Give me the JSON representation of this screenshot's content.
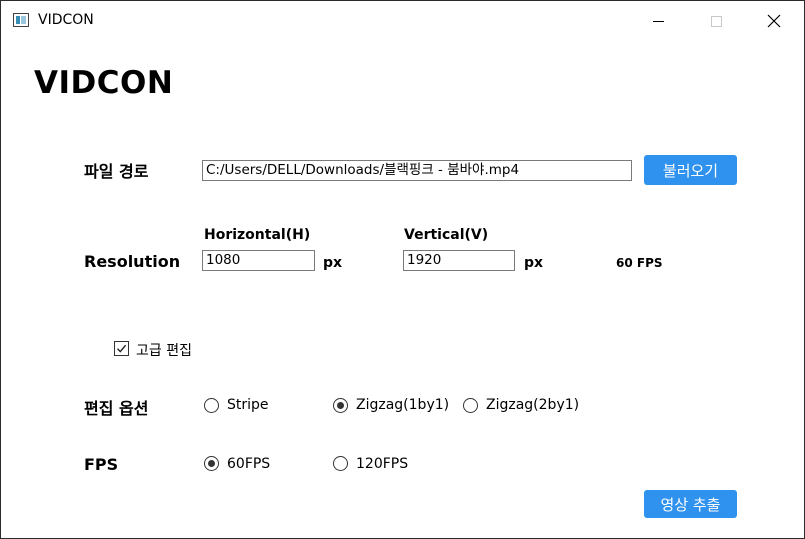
{
  "window": {
    "title": "VIDCON",
    "controls": {
      "minimize": "minimize",
      "maximize": "maximize",
      "close": "close"
    }
  },
  "heading": "VIDCON",
  "file_path": {
    "label": "파일 경로",
    "value": "C:/Users/DELL/Downloads/블랙핑크 - 붐바야.mp4",
    "load_button": "불러오기"
  },
  "resolution": {
    "label": "Resolution",
    "horizontal_label": "Horizontal(H)",
    "horizontal_value": "1080",
    "vertical_label": "Vertical(V)",
    "vertical_value": "1920",
    "unit": "px",
    "fps_readout": "60 FPS"
  },
  "advanced_edit": {
    "label": "고급 편집",
    "checked": true
  },
  "edit_options": {
    "label": "편집 옵션",
    "options": [
      {
        "label": "Stripe",
        "selected": false
      },
      {
        "label": "Zigzag(1by1)",
        "selected": true
      },
      {
        "label": "Zigzag(2by1)",
        "selected": false
      }
    ]
  },
  "fps": {
    "label": "FPS",
    "options": [
      {
        "label": "60FPS",
        "selected": true
      },
      {
        "label": "120FPS",
        "selected": false
      }
    ]
  },
  "extract_button": "영상 추출",
  "colors": {
    "accent": "#2f92ee",
    "border": "#7a7a7a"
  }
}
